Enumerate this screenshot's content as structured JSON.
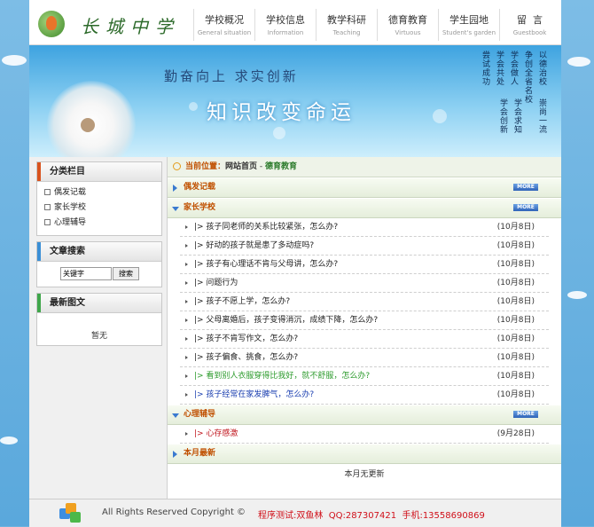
{
  "header": {
    "school_name": "长城中学",
    "nav": [
      {
        "cn": "学校概况",
        "en": "General situation"
      },
      {
        "cn": "学校信息",
        "en": "Information"
      },
      {
        "cn": "教学科研",
        "en": "Teaching"
      },
      {
        "cn": "德育教育",
        "en": "Virtuous"
      },
      {
        "cn": "学生园地",
        "en": "Student's garden"
      },
      {
        "cn": "留  言",
        "en": "Guestbook"
      }
    ]
  },
  "banner": {
    "slogan1": "勤奋向上 求实创新",
    "slogan2": "知识改变命运",
    "poem_cols": [
      "以德治校",
      "争创全省名校",
      "学会做人",
      "学会共处",
      "尝试成功",
      "崇尚一流",
      "学会求知",
      "学会创新"
    ]
  },
  "sidebar": {
    "category_title": "分类栏目",
    "categories": [
      "偶发记载",
      "家长学校",
      "心理辅导"
    ],
    "search_title": "文章搜索",
    "search_value": "关键字",
    "search_button": "搜索",
    "latest_title": "最新图文",
    "latest_empty": "暂无"
  },
  "main": {
    "crumb_label": "当前位置：",
    "crumb_home": "网站首页",
    "crumb_sep": " - ",
    "crumb_current": "德育教育",
    "more_label": "MORE",
    "sections": {
      "s1": "偶发记载",
      "s2": "家长学校",
      "s3": "心理辅导",
      "s4": "本月最新"
    },
    "articles": [
      {
        "title": "|> 孩子同老师的关系比较紧张，怎么办?",
        "date": "(10月8日)"
      },
      {
        "title": "|> 好动的孩子就是患了多动症吗?",
        "date": "(10月8日)"
      },
      {
        "title": "|> 孩子有心理话不肯与父母讲，怎么办?",
        "date": "(10月8日)"
      },
      {
        "title": "|> 问题行为",
        "date": "(10月8日)"
      },
      {
        "title": "|> 孩子不愿上学，怎么办?",
        "date": "(10月8日)"
      },
      {
        "title": "|> 父母离婚后，孩子变得消沉，成绩下降，怎么办?",
        "date": "(10月8日)"
      },
      {
        "title": "|> 孩子不肯写作文，怎么办?",
        "date": "(10月8日)"
      },
      {
        "title": "|> 孩子偏食、挑食，怎么办?",
        "date": "(10月8日)"
      },
      {
        "title": "|> 看到别人衣服穿得比我好，就不舒服，怎么办?",
        "date": "(10月8日)"
      },
      {
        "title": "|> 孩子经常在家发脾气，怎么办?",
        "date": "(10月8日)"
      }
    ],
    "psych_articles": [
      {
        "title": "|> 心存感激",
        "date": "(9月28日)"
      }
    ],
    "month_empty": "本月无更新"
  },
  "footer": {
    "copyright": "All Rights Reserved Copyright ©",
    "contact": "程序测试:双鱼林  QQ:287307421  手机:13558690869"
  }
}
